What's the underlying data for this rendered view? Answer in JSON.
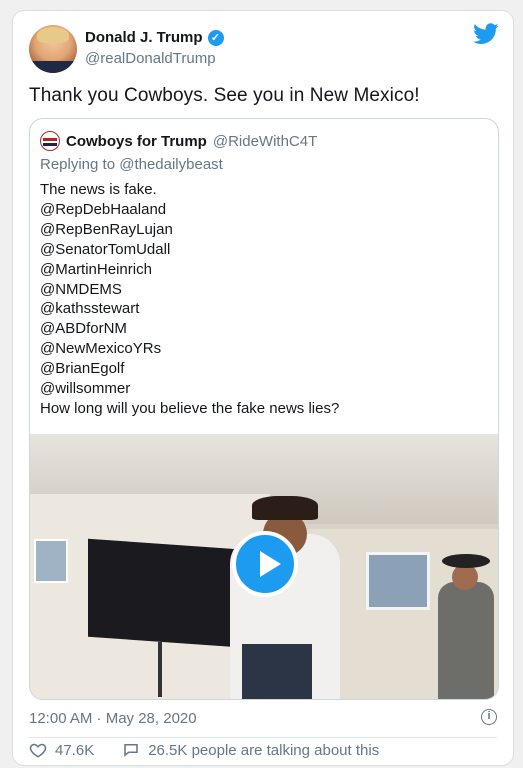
{
  "tweet": {
    "author_name": "Donald J. Trump",
    "author_handle": "@realDonaldTrump",
    "text": "Thank you Cowboys. See you in New Mexico!",
    "timestamp": "12:00 AM · May 28, 2020",
    "likes": "47.6K",
    "replies_text": "26.5K people are talking about this"
  },
  "quoted": {
    "author_name": "Cowboys for Trump",
    "author_handle": "@RideWithC4T",
    "replying_to": "Replying to @thedailybeast",
    "lines": [
      "The news is fake.",
      "@RepDebHaaland",
      "@RepBenRayLujan",
      "@SenatorTomUdall",
      "@MartinHeinrich",
      "@NMDEMS",
      "@kathsstewart",
      "@ABDforNM",
      "@NewMexicoYRs",
      "@BrianEgolf",
      "@willsommer",
      "How long will you believe the fake news lies?"
    ]
  },
  "icons": {
    "verified": "verified-badge-icon",
    "brand": "twitter-bird-icon",
    "play": "play-icon",
    "info": "info-icon",
    "like": "heart-icon",
    "reply": "speech-bubble-icon"
  },
  "colors": {
    "accent": "#1d9bf0",
    "text": "#14171a",
    "muted": "#657786"
  }
}
